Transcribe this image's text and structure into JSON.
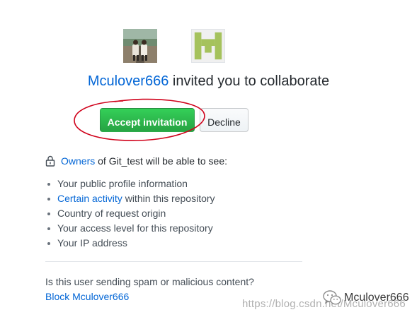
{
  "invite": {
    "username": "Mculover666",
    "headline_suffix": " invited you to collaborate",
    "accept_label": "Accept invitation",
    "decline_label": "Decline"
  },
  "permissions": {
    "owners_link": "Owners",
    "intro_suffix": " of Git_test will be able to see:",
    "items": {
      "profile": "Your public profile information",
      "activity_link": "Certain activity",
      "activity_suffix": " within this repository",
      "country": "Country of request origin",
      "access": "Your access level for this repository",
      "ip": "Your IP address"
    }
  },
  "spam": {
    "question": "Is this user sending spam or malicious content?",
    "block_link": "Block Mculover666"
  },
  "watermark": {
    "name": "Mculover666",
    "url": "https://blog.csdn.net/Mculover666"
  },
  "icons": {
    "lock": "lock-icon",
    "user_avatar": "user-avatar",
    "repo_avatar": "identicon"
  },
  "colors": {
    "link": "#0366d6",
    "accept_button": "#28a745",
    "annotation_circle": "#d0021b"
  }
}
